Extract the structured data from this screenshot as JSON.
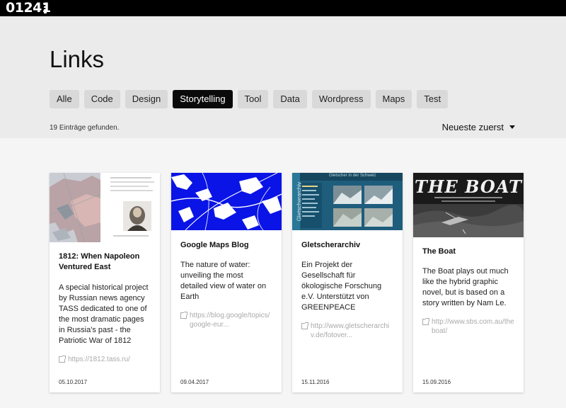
{
  "brand": {
    "logo_text": "01241",
    "logo_icon": "bars-icon"
  },
  "page": {
    "title": "Links"
  },
  "filters": [
    {
      "label": "Alle",
      "active": false
    },
    {
      "label": "Code",
      "active": false
    },
    {
      "label": "Design",
      "active": false
    },
    {
      "label": "Storytelling",
      "active": true
    },
    {
      "label": "Tool",
      "active": false
    },
    {
      "label": "Data",
      "active": false
    },
    {
      "label": "Wordpress",
      "active": false
    },
    {
      "label": "Maps",
      "active": false
    },
    {
      "label": "Test",
      "active": false
    }
  ],
  "results": {
    "count_text": "19 Einträge gefunden."
  },
  "sort": {
    "label": "Neueste zuerst",
    "icon": "caret-down-icon"
  },
  "cards": [
    {
      "title": "1812: When Napoleon Ventured East",
      "description": "A special historical project by Russian news agency TASS dedicated to one of the most dramatic pages in Russia's past - the Patriotic War of 1812",
      "link": "https://1812.tass.ru/",
      "date": "05.10.2017",
      "image": "napoleon-map-thumbnail"
    },
    {
      "title": "Google Maps Blog",
      "description": "The nature of water: unveiling the most detailed view of water on Earth",
      "link": "https://blog.google/topics/google-eur...",
      "date": "09.04.2017",
      "image": "water-map-thumbnail"
    },
    {
      "title": "Gletscherarchiv",
      "description": "Ein Projekt der Gesellschaft für ökologische Forschung e.V. Unterstützt von GREENPEACE",
      "link": "http://www.gletscherarchiv.de/fotover...",
      "date": "15.11.2016",
      "image": "glacier-archive-thumbnail",
      "thumb_header": "Gletscher in der Schweiz",
      "thumb_side_label": "Gletscherarchiv"
    },
    {
      "title": "The Boat",
      "description": "The Boat plays out much like the hybrid graphic novel, but is based on a story written by Nam Le.",
      "link": "http://www.sbs.com.au/theboat/",
      "date": "15.09.2016",
      "image": "the-boat-thumbnail",
      "thumb_title": "THE BOAT"
    }
  ],
  "colors": {
    "active_filter": "#0a0a0a",
    "filter_bg": "#d9d9d9",
    "header_bg": "#ebebeb",
    "water_blue": "#0a14e6",
    "glacier_panel": "#1f5d7c"
  }
}
